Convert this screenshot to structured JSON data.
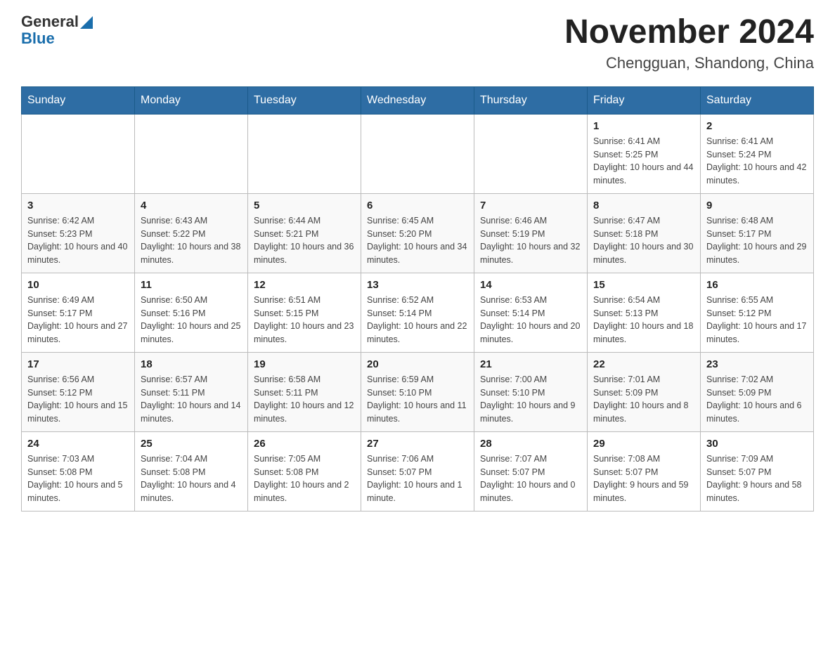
{
  "header": {
    "logo_general": "General",
    "logo_blue": "Blue",
    "month_title": "November 2024",
    "location": "Chengguan, Shandong, China"
  },
  "calendar": {
    "days_of_week": [
      "Sunday",
      "Monday",
      "Tuesday",
      "Wednesday",
      "Thursday",
      "Friday",
      "Saturday"
    ],
    "weeks": [
      [
        {
          "day": "",
          "info": ""
        },
        {
          "day": "",
          "info": ""
        },
        {
          "day": "",
          "info": ""
        },
        {
          "day": "",
          "info": ""
        },
        {
          "day": "",
          "info": ""
        },
        {
          "day": "1",
          "info": "Sunrise: 6:41 AM\nSunset: 5:25 PM\nDaylight: 10 hours and 44 minutes."
        },
        {
          "day": "2",
          "info": "Sunrise: 6:41 AM\nSunset: 5:24 PM\nDaylight: 10 hours and 42 minutes."
        }
      ],
      [
        {
          "day": "3",
          "info": "Sunrise: 6:42 AM\nSunset: 5:23 PM\nDaylight: 10 hours and 40 minutes."
        },
        {
          "day": "4",
          "info": "Sunrise: 6:43 AM\nSunset: 5:22 PM\nDaylight: 10 hours and 38 minutes."
        },
        {
          "day": "5",
          "info": "Sunrise: 6:44 AM\nSunset: 5:21 PM\nDaylight: 10 hours and 36 minutes."
        },
        {
          "day": "6",
          "info": "Sunrise: 6:45 AM\nSunset: 5:20 PM\nDaylight: 10 hours and 34 minutes."
        },
        {
          "day": "7",
          "info": "Sunrise: 6:46 AM\nSunset: 5:19 PM\nDaylight: 10 hours and 32 minutes."
        },
        {
          "day": "8",
          "info": "Sunrise: 6:47 AM\nSunset: 5:18 PM\nDaylight: 10 hours and 30 minutes."
        },
        {
          "day": "9",
          "info": "Sunrise: 6:48 AM\nSunset: 5:17 PM\nDaylight: 10 hours and 29 minutes."
        }
      ],
      [
        {
          "day": "10",
          "info": "Sunrise: 6:49 AM\nSunset: 5:17 PM\nDaylight: 10 hours and 27 minutes."
        },
        {
          "day": "11",
          "info": "Sunrise: 6:50 AM\nSunset: 5:16 PM\nDaylight: 10 hours and 25 minutes."
        },
        {
          "day": "12",
          "info": "Sunrise: 6:51 AM\nSunset: 5:15 PM\nDaylight: 10 hours and 23 minutes."
        },
        {
          "day": "13",
          "info": "Sunrise: 6:52 AM\nSunset: 5:14 PM\nDaylight: 10 hours and 22 minutes."
        },
        {
          "day": "14",
          "info": "Sunrise: 6:53 AM\nSunset: 5:14 PM\nDaylight: 10 hours and 20 minutes."
        },
        {
          "day": "15",
          "info": "Sunrise: 6:54 AM\nSunset: 5:13 PM\nDaylight: 10 hours and 18 minutes."
        },
        {
          "day": "16",
          "info": "Sunrise: 6:55 AM\nSunset: 5:12 PM\nDaylight: 10 hours and 17 minutes."
        }
      ],
      [
        {
          "day": "17",
          "info": "Sunrise: 6:56 AM\nSunset: 5:12 PM\nDaylight: 10 hours and 15 minutes."
        },
        {
          "day": "18",
          "info": "Sunrise: 6:57 AM\nSunset: 5:11 PM\nDaylight: 10 hours and 14 minutes."
        },
        {
          "day": "19",
          "info": "Sunrise: 6:58 AM\nSunset: 5:11 PM\nDaylight: 10 hours and 12 minutes."
        },
        {
          "day": "20",
          "info": "Sunrise: 6:59 AM\nSunset: 5:10 PM\nDaylight: 10 hours and 11 minutes."
        },
        {
          "day": "21",
          "info": "Sunrise: 7:00 AM\nSunset: 5:10 PM\nDaylight: 10 hours and 9 minutes."
        },
        {
          "day": "22",
          "info": "Sunrise: 7:01 AM\nSunset: 5:09 PM\nDaylight: 10 hours and 8 minutes."
        },
        {
          "day": "23",
          "info": "Sunrise: 7:02 AM\nSunset: 5:09 PM\nDaylight: 10 hours and 6 minutes."
        }
      ],
      [
        {
          "day": "24",
          "info": "Sunrise: 7:03 AM\nSunset: 5:08 PM\nDaylight: 10 hours and 5 minutes."
        },
        {
          "day": "25",
          "info": "Sunrise: 7:04 AM\nSunset: 5:08 PM\nDaylight: 10 hours and 4 minutes."
        },
        {
          "day": "26",
          "info": "Sunrise: 7:05 AM\nSunset: 5:08 PM\nDaylight: 10 hours and 2 minutes."
        },
        {
          "day": "27",
          "info": "Sunrise: 7:06 AM\nSunset: 5:07 PM\nDaylight: 10 hours and 1 minute."
        },
        {
          "day": "28",
          "info": "Sunrise: 7:07 AM\nSunset: 5:07 PM\nDaylight: 10 hours and 0 minutes."
        },
        {
          "day": "29",
          "info": "Sunrise: 7:08 AM\nSunset: 5:07 PM\nDaylight: 9 hours and 59 minutes."
        },
        {
          "day": "30",
          "info": "Sunrise: 7:09 AM\nSunset: 5:07 PM\nDaylight: 9 hours and 58 minutes."
        }
      ]
    ]
  }
}
